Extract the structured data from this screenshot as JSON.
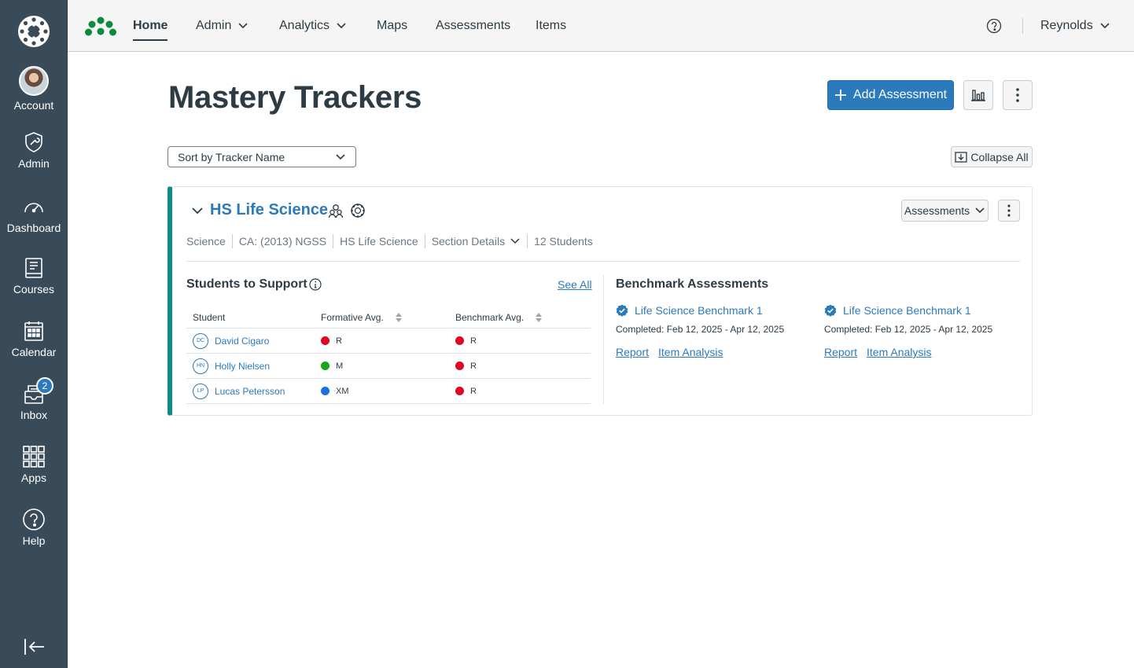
{
  "global_nav": {
    "items": [
      {
        "label": "Account",
        "icon": "avatar"
      },
      {
        "label": "Admin",
        "icon": "shield-wrench-icon"
      },
      {
        "label": "Dashboard",
        "icon": "speedometer-icon"
      },
      {
        "label": "Courses",
        "icon": "book-icon"
      },
      {
        "label": "Calendar",
        "icon": "calendar-icon"
      },
      {
        "label": "Inbox",
        "icon": "inbox-icon",
        "badge": "2"
      },
      {
        "label": "Apps",
        "icon": "grid-icon"
      },
      {
        "label": "Help",
        "icon": "help-icon"
      }
    ]
  },
  "topbar": {
    "tabs": [
      {
        "label": "Home",
        "active": true
      },
      {
        "label": "Admin",
        "dropdown": true
      },
      {
        "label": "Analytics",
        "dropdown": true
      },
      {
        "label": "Maps"
      },
      {
        "label": "Assessments"
      },
      {
        "label": "Items"
      }
    ],
    "user": "Reynolds"
  },
  "page": {
    "title": "Mastery Trackers",
    "add_button": "Add Assessment",
    "sort_select": "Sort by Tracker Name",
    "collapse_button": "Collapse All"
  },
  "tracker": {
    "title": "HS Life Science",
    "assessments_button": "Assessments",
    "meta": [
      "Science",
      "CA: (2013) NGSS",
      "HS Life Science",
      "Section Details",
      "12 Students"
    ],
    "support": {
      "heading": "Students to Support",
      "see_all": "See All",
      "columns": [
        "Student",
        "Formative Avg.",
        "Benchmark Avg."
      ],
      "rows": [
        {
          "initials": "DC",
          "name": "David Cigaro",
          "formative": "R",
          "formative_color": "#e0061f",
          "benchmark": "R",
          "benchmark_color": "#e0061f"
        },
        {
          "initials": "HN",
          "name": "Holly Nielsen",
          "formative": "M",
          "formative_color": "#13a81b",
          "benchmark": "R",
          "benchmark_color": "#e0061f"
        },
        {
          "initials": "LP",
          "name": "Lucas Petersson",
          "formative": "XM",
          "formative_color": "#1e70e0",
          "benchmark": "R",
          "benchmark_color": "#e0061f"
        }
      ]
    },
    "benchmarks": {
      "heading": "Benchmark Assessments",
      "items": [
        {
          "title": "Life Science Benchmark 1",
          "completed": "Completed: Feb 12, 2025 - Apr 12, 2025",
          "report": "Report",
          "analysis": "Item Analysis"
        },
        {
          "title": "Life Science Benchmark 1",
          "completed": "Completed: Feb 12, 2025 - Apr 12, 2025",
          "report": "Report",
          "analysis": "Item Analysis"
        }
      ]
    }
  }
}
